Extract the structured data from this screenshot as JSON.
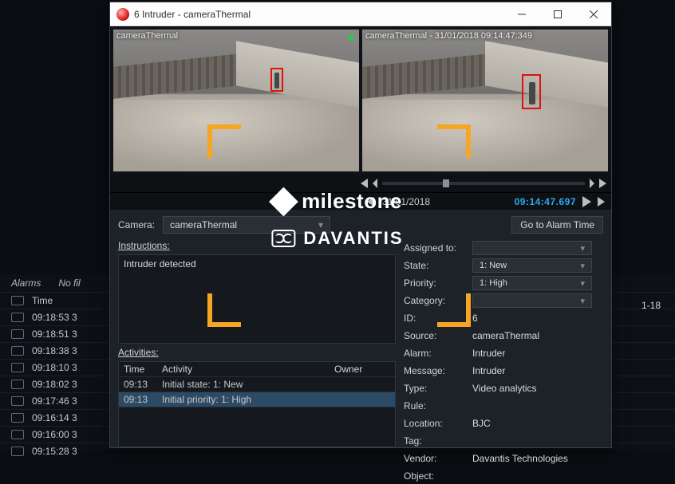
{
  "bg": {
    "alarms_label": "Alarms",
    "no_filter": "No fil",
    "time_col": "Time",
    "rows": [
      "09:18:53 3",
      "09:18:51 3",
      "09:18:38 3",
      "09:18:10 3",
      "09:18:02 3",
      "09:17:46 3",
      "09:16:14 3",
      "09:16:00 3",
      "09:15:28 3"
    ],
    "right_badge": "1-18"
  },
  "window": {
    "title": "6 Intruder - cameraThermal",
    "cam_left_label": "cameraThermal",
    "cam_right_label": "cameraThermal - 31/01/2018 09:14:47:349",
    "playback_date": "31/01/2018",
    "playback_time": "09:14:47.697",
    "camera_label": "Camera:",
    "camera_value": "cameraThermal",
    "goto_btn": "Go to Alarm Time",
    "instructions_label": "Instructions:",
    "instructions_text": "Intruder detected",
    "activities_label": "Activities:",
    "activities_cols": {
      "time": "Time",
      "activity": "Activity",
      "owner": "Owner"
    },
    "activities_rows": [
      {
        "time": "09:13",
        "activity": "Initial state: 1: New",
        "owner": ""
      },
      {
        "time": "09:13",
        "activity": "Initial priority: 1: High",
        "owner": ""
      }
    ],
    "details": {
      "assigned_to": {
        "label": "Assigned to:",
        "value": ""
      },
      "state": {
        "label": "State:",
        "value": "1: New"
      },
      "priority": {
        "label": "Priority:",
        "value": "1: High"
      },
      "category": {
        "label": "Category:",
        "value": ""
      },
      "id": {
        "label": "ID:",
        "value": "6"
      },
      "source": {
        "label": "Source:",
        "value": "cameraThermal"
      },
      "alarm": {
        "label": "Alarm:",
        "value": "Intruder"
      },
      "message": {
        "label": "Message:",
        "value": "Intruder"
      },
      "type": {
        "label": "Type:",
        "value": "Video analytics"
      },
      "rule": {
        "label": "Rule:",
        "value": ""
      },
      "location": {
        "label": "Location:",
        "value": "BJC"
      },
      "tag": {
        "label": "Tag:",
        "value": ""
      },
      "vendor": {
        "label": "Vendor:",
        "value": "Davantis Technologies"
      },
      "object": {
        "label": "Object:",
        "value": ""
      }
    }
  },
  "overlay": {
    "milestone": "milestone",
    "davantis": "DAVANTIS"
  }
}
